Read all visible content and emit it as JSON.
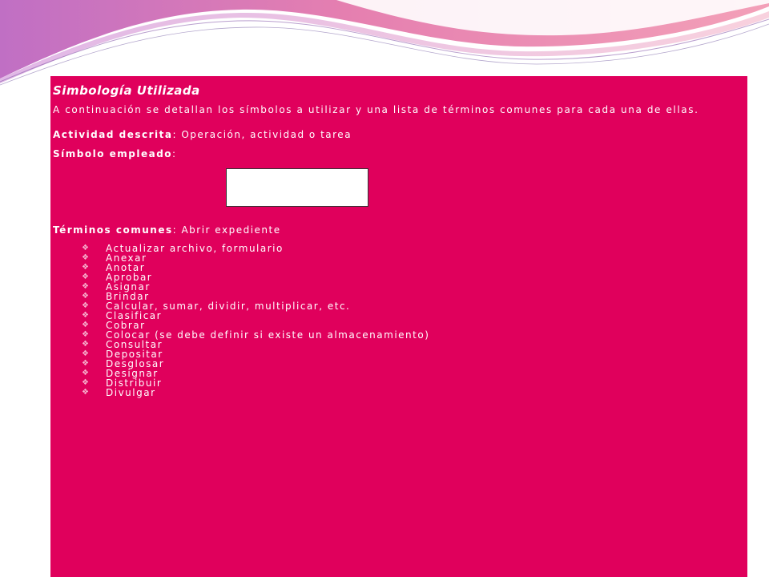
{
  "document": {
    "title": "Simbología Utilizada",
    "intro": "A continuación se detallan los símbolos a utilizar y una lista de términos comunes para cada una de ellas.",
    "activity_label": "Actividad descrita",
    "activity_value": ": Operación, actividad o tarea",
    "symbol_label": "Símbolo empleado",
    "symbol_suffix": ":",
    "terms_label": "Términos comunes",
    "terms_first": ": Abrir expediente",
    "bullet_glyph": "❖",
    "terms": [
      "Actualizar archivo, formulario",
      "Anexar",
      "Anotar",
      "Aprobar",
      "Asignar",
      "Brindar",
      "Calcular, sumar, dividir, multiplicar, etc.",
      "Clasificar",
      "Cobrar",
      "Colocar (se debe definir si existe un almacenamiento)",
      "Consultar",
      "Depositar",
      "Desglosar",
      "Designar",
      "Distribuir",
      "Divulgar"
    ]
  },
  "colors": {
    "panel_background": "#e0005c",
    "text": "#ffffff",
    "bullet": "#f7b3cf",
    "wave_pink": "#f07fa8",
    "wave_purple": "#c77fcf"
  }
}
